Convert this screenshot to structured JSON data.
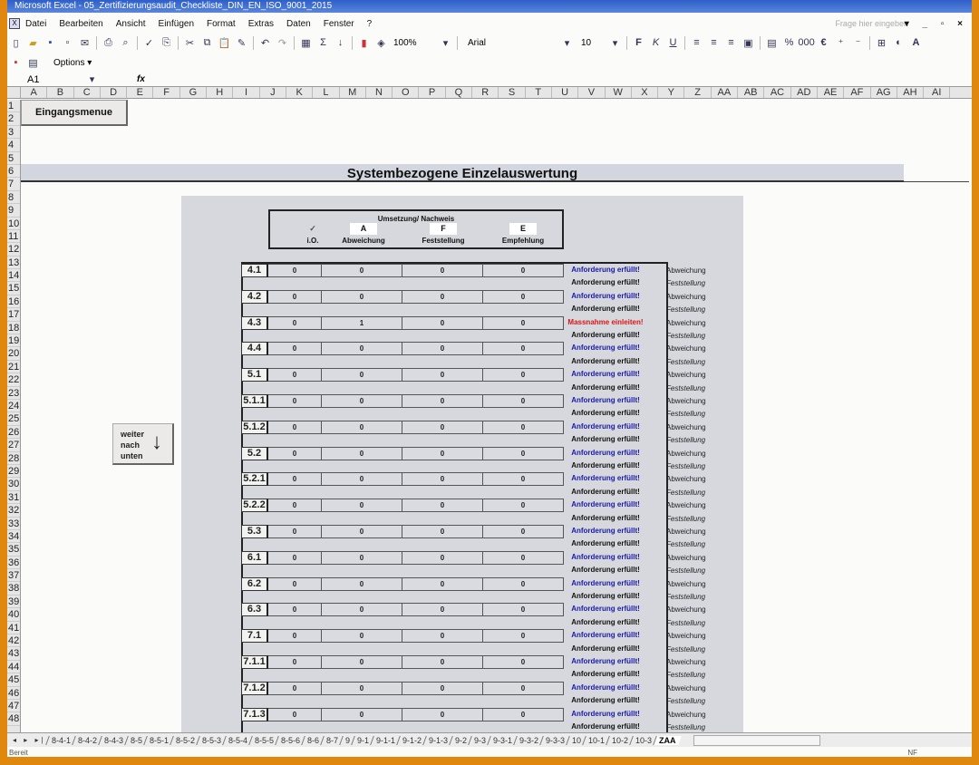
{
  "window": {
    "title": "Microsoft Excel - 05_Zertifizierungsaudit_Checkliste_DIN_EN_ISO_9001_2015",
    "help_placeholder": "Frage hier eingeben",
    "controls": "▾ _ ▫ ×"
  },
  "menu": [
    "Datei",
    "Bearbeiten",
    "Ansicht",
    "Einfügen",
    "Format",
    "Extras",
    "Daten",
    "Fenster",
    "?"
  ],
  "toolbar": {
    "zoom": "100%",
    "font": "Arial",
    "font_size": "10",
    "bold": "F",
    "italic": "K",
    "underline": "U",
    "options_label": "Options ▾"
  },
  "formula_bar": {
    "name_box": "A1",
    "fx": "fx",
    "value": ""
  },
  "columns": [
    "A",
    "B",
    "C",
    "D",
    "E",
    "F",
    "G",
    "H",
    "I",
    "J",
    "K",
    "L",
    "M",
    "N",
    "O",
    "P",
    "Q",
    "R",
    "S",
    "T",
    "U",
    "V",
    "W",
    "X",
    "Y",
    "Z",
    "AA",
    "AB",
    "AC",
    "AD",
    "AE",
    "AF",
    "AG",
    "AH",
    "AI"
  ],
  "rows": [
    "1",
    "2",
    "3",
    "4",
    "5",
    "6",
    "7",
    "8",
    "9",
    "10",
    "11",
    "12",
    "13",
    "14",
    "15",
    "16",
    "17",
    "18",
    "19",
    "20",
    "21",
    "22",
    "23",
    "24",
    "25",
    "26",
    "27",
    "28",
    "29",
    "30",
    "31",
    "32",
    "33",
    "34",
    "35",
    "36",
    "37",
    "38",
    "39",
    "40",
    "41",
    "42",
    "43",
    "44",
    "45",
    "46",
    "47",
    "48"
  ],
  "sheet": {
    "menu_button": "Eingangsmenue",
    "title": "Systembezogene Einzelauswertung",
    "scroll_button": "weiter\nnach\nunten",
    "scroll_button_lines": [
      "weiter",
      "nach",
      "unten"
    ],
    "legend": {
      "header": "Umsetzung/ Nachweis",
      "columns": [
        {
          "key": "✓",
          "label": "i.O."
        },
        {
          "key": "A",
          "label": "Abweichung"
        },
        {
          "key": "F",
          "label": "Feststellung"
        },
        {
          "key": "E",
          "label": "Empfehlung"
        }
      ]
    },
    "sections": [
      {
        "id": "4.1",
        "io": "0",
        "a": "0",
        "f": "0",
        "e": "0",
        "status_a": "Anforderung erfüllt!",
        "status_a_type": "blue",
        "status_f": "Anforderung erfüllt!"
      },
      {
        "id": "4.2",
        "io": "0",
        "a": "0",
        "f": "0",
        "e": "0",
        "status_a": "Anforderung erfüllt!",
        "status_a_type": "blue",
        "status_f": "Anforderung erfüllt!"
      },
      {
        "id": "4.3",
        "io": "0",
        "a": "1",
        "f": "0",
        "e": "0",
        "status_a": "Massnahme einleiten!",
        "status_a_type": "red",
        "status_f": "Anforderung erfüllt!"
      },
      {
        "id": "4.4",
        "io": "0",
        "a": "0",
        "f": "0",
        "e": "0",
        "status_a": "Anforderung erfüllt!",
        "status_a_type": "blue",
        "status_f": "Anforderung erfüllt!"
      },
      {
        "id": "5.1",
        "io": "0",
        "a": "0",
        "f": "0",
        "e": "0",
        "status_a": "Anforderung erfüllt!",
        "status_a_type": "blue",
        "status_f": "Anforderung erfüllt!"
      },
      {
        "id": "5.1.1",
        "io": "0",
        "a": "0",
        "f": "0",
        "e": "0",
        "status_a": "Anforderung erfüllt!",
        "status_a_type": "blue",
        "status_f": "Anforderung erfüllt!"
      },
      {
        "id": "5.1.2",
        "io": "0",
        "a": "0",
        "f": "0",
        "e": "0",
        "status_a": "Anforderung erfüllt!",
        "status_a_type": "blue",
        "status_f": "Anforderung erfüllt!"
      },
      {
        "id": "5.2",
        "io": "0",
        "a": "0",
        "f": "0",
        "e": "0",
        "status_a": "Anforderung erfüllt!",
        "status_a_type": "blue",
        "status_f": "Anforderung erfüllt!"
      },
      {
        "id": "5.2.1",
        "io": "0",
        "a": "0",
        "f": "0",
        "e": "0",
        "status_a": "Anforderung erfüllt!",
        "status_a_type": "blue",
        "status_f": "Anforderung erfüllt!"
      },
      {
        "id": "5.2.2",
        "io": "0",
        "a": "0",
        "f": "0",
        "e": "0",
        "status_a": "Anforderung erfüllt!",
        "status_a_type": "blue",
        "status_f": "Anforderung erfüllt!"
      },
      {
        "id": "5.3",
        "io": "0",
        "a": "0",
        "f": "0",
        "e": "0",
        "status_a": "Anforderung erfüllt!",
        "status_a_type": "blue",
        "status_f": "Anforderung erfüllt!"
      },
      {
        "id": "6.1",
        "io": "0",
        "a": "0",
        "f": "0",
        "e": "0",
        "status_a": "Anforderung erfüllt!",
        "status_a_type": "blue",
        "status_f": "Anforderung erfüllt!"
      },
      {
        "id": "6.2",
        "io": "0",
        "a": "0",
        "f": "0",
        "e": "0",
        "status_a": "Anforderung erfüllt!",
        "status_a_type": "blue",
        "status_f": "Anforderung erfüllt!"
      },
      {
        "id": "6.3",
        "io": "0",
        "a": "0",
        "f": "0",
        "e": "0",
        "status_a": "Anforderung erfüllt!",
        "status_a_type": "blue",
        "status_f": "Anforderung erfüllt!"
      },
      {
        "id": "7.1",
        "io": "0",
        "a": "0",
        "f": "0",
        "e": "0",
        "status_a": "Anforderung erfüllt!",
        "status_a_type": "blue",
        "status_f": "Anforderung erfüllt!"
      },
      {
        "id": "7.1.1",
        "io": "0",
        "a": "0",
        "f": "0",
        "e": "0",
        "status_a": "Anforderung erfüllt!",
        "status_a_type": "blue",
        "status_f": "Anforderung erfüllt!"
      },
      {
        "id": "7.1.2",
        "io": "0",
        "a": "0",
        "f": "0",
        "e": "0",
        "status_a": "Anforderung erfüllt!",
        "status_a_type": "blue",
        "status_f": "Anforderung erfüllt!"
      },
      {
        "id": "7.1.3",
        "io": "0",
        "a": "0",
        "f": "0",
        "e": "0",
        "status_a": "Anforderung erfüllt!",
        "status_a_type": "blue",
        "status_f": "Anforderung erfüllt!"
      }
    ],
    "category_a": "Abweichung",
    "category_f": "Feststellung"
  },
  "tabs": [
    "8-4-1",
    "8-4-2",
    "8-4-3",
    "8-5",
    "8-5-1",
    "8-5-2",
    "8-5-3",
    "8-5-4",
    "8-5-5",
    "8-5-6",
    "8-6",
    "8-7",
    "9",
    "9-1",
    "9-1-1",
    "9-1-2",
    "9-1-3",
    "9-2",
    "9-3",
    "9-3-1",
    "9-3-2",
    "9-3-3",
    "10",
    "10-1",
    "10-2",
    "10-3",
    "ZAA"
  ],
  "active_tab": "ZAA",
  "tab_nav": "◂ ▸ ▸|",
  "statusbar": {
    "left": "Bereit",
    "right": "NF"
  },
  "colors": {
    "frame": "#e0870e",
    "panel": "#d6d8dd",
    "status_ok": "#1a1aa8",
    "status_action": "#d81818"
  }
}
